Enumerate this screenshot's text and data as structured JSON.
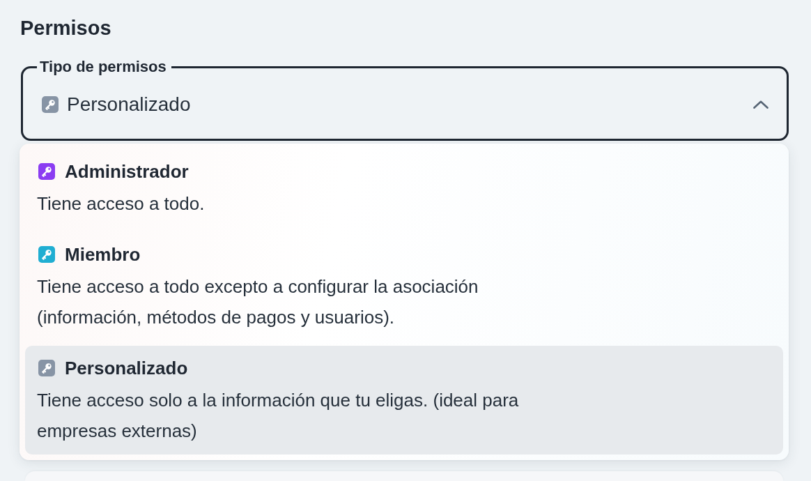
{
  "section_title": "Permisos",
  "permission_select": {
    "label": "Tipo de permisos",
    "value": "Personalizado",
    "expanded": true,
    "options": [
      {
        "title": "Administrador",
        "description": "Tiene acceso a todo.",
        "color": "#8b3df2",
        "selected": false
      },
      {
        "title": "Miembro",
        "description": "Tiene acceso a todo excepto a configurar la asociación (información, métodos de pagos y usuarios).",
        "color": "#20aed2",
        "selected": false
      },
      {
        "title": "Personalizado",
        "description": "Tiene acceso solo a la información que tu eligas. (ideal para empresas externas)",
        "color": "#8794a5",
        "selected": true
      }
    ]
  }
}
